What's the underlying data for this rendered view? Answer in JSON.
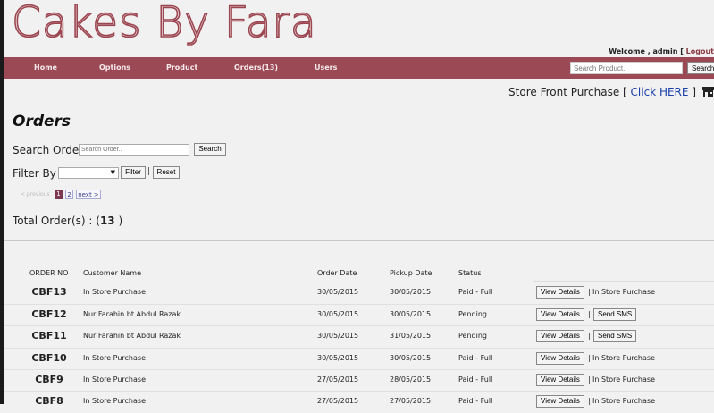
{
  "brand": {
    "logo_text": "Cakes By Fara",
    "accent": "#9b4a55"
  },
  "welcome": {
    "text": "Welcome , admin [",
    "logout": "Logout"
  },
  "nav": {
    "items": [
      "Home",
      "Options",
      "Product",
      "Orders(13)",
      "Users"
    ],
    "search_placeholder": "Search Product..",
    "search_button": "Search"
  },
  "storefront": {
    "prefix": "Store Front Purchase [",
    "link": "Click HERE",
    "suffix": "]"
  },
  "page": {
    "title": "Orders"
  },
  "search": {
    "label": "Search Order :",
    "placeholder": "Search Order..",
    "button": "Search"
  },
  "filter": {
    "label": "Filter By :",
    "selected": "",
    "filter_button": "Filter",
    "separator": "|",
    "reset_button": "Reset"
  },
  "pagination": {
    "prev": "< previous",
    "pages": [
      "1",
      "2"
    ],
    "next": "next >",
    "current": "1"
  },
  "total": {
    "label": "Total Order(s) :",
    "value_open": "(",
    "count": "13",
    "value_close": ")"
  },
  "table": {
    "headers": [
      "ORDER NO",
      "Customer Name",
      "Order Date",
      "Pickup Date",
      "Status"
    ],
    "rows": [
      {
        "id": "CBF13",
        "customer": "In Store Purchase",
        "order_date": "30/05/2015",
        "pickup_date": "30/05/2015",
        "status": "Paid - Full",
        "action": "View Details",
        "extra": "In Store Purchase",
        "extra_is_button": false
      },
      {
        "id": "CBF12",
        "customer": "Nur Farahin bt Abdul Razak",
        "order_date": "30/05/2015",
        "pickup_date": "30/05/2015",
        "status": "Pending",
        "action": "View Details",
        "extra": "Send SMS",
        "extra_is_button": true
      },
      {
        "id": "CBF11",
        "customer": "Nur Farahin bt Abdul Razak",
        "order_date": "30/05/2015",
        "pickup_date": "31/05/2015",
        "status": "Pending",
        "action": "View Details",
        "extra": "Send SMS",
        "extra_is_button": true
      },
      {
        "id": "CBF10",
        "customer": "In Store Purchase",
        "order_date": "30/05/2015",
        "pickup_date": "30/05/2015",
        "status": "Paid - Full",
        "action": "View Details",
        "extra": "In Store Purchase",
        "extra_is_button": false
      },
      {
        "id": "CBF9",
        "customer": "In Store Purchase",
        "order_date": "27/05/2015",
        "pickup_date": "28/05/2015",
        "status": "Paid - Full",
        "action": "View Details",
        "extra": "In Store Purchase",
        "extra_is_button": false
      },
      {
        "id": "CBF8",
        "customer": "In Store Purchase",
        "order_date": "27/05/2015",
        "pickup_date": "27/05/2015",
        "status": "Paid - Full",
        "action": "View Details",
        "extra": "In Store Purchase",
        "extra_is_button": false
      }
    ]
  }
}
